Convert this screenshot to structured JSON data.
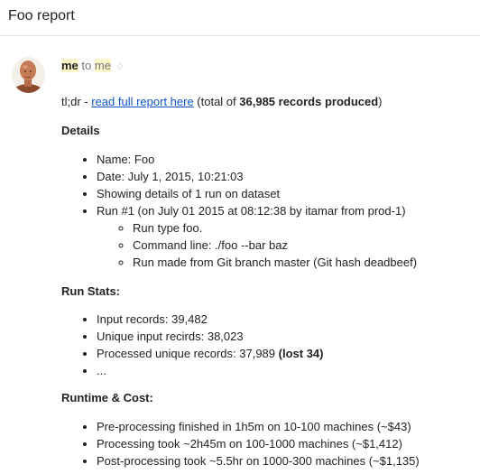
{
  "subject": "Foo report",
  "sender": {
    "name": "me",
    "to_word": "to",
    "recipient": "me",
    "details_toggle": "♢"
  },
  "tldr": {
    "prefix": "tl;dr - ",
    "link_text": "read full report here",
    "middle": " (total of ",
    "count": "36,985 records produced",
    "suffix": ")"
  },
  "details": {
    "heading": "Details",
    "items": [
      "Name: Foo",
      "Date: July 1, 2015, 10:21:03",
      "Showing details of 1 run on dataset",
      "Run #1 (on July 01 2015 at 08:12:38 by itamar from prod-1)"
    ],
    "run_items": [
      "Run type foo.",
      "Command line: ./foo --bar baz",
      "Run made from Git branch master (Git hash deadbeef)"
    ]
  },
  "run_stats": {
    "heading": "Run Stats:",
    "items": [
      "Input records: 39,482",
      "Unique input recirds: 38,023"
    ],
    "processed_prefix": "Processed unique records: 37,989 ",
    "processed_lost": "(lost 34)",
    "ellipsis": "..."
  },
  "runtime_cost": {
    "heading": "Runtime & Cost:",
    "items": [
      "Pre-processing finished in 1h5m on 10-100 machines (~$43)",
      "Processing took ~2h45m on 100-1000 machines (~$1,412)",
      "Post-processing took ~5.5hr on 1000-300 machines (~$1,135)"
    ]
  }
}
